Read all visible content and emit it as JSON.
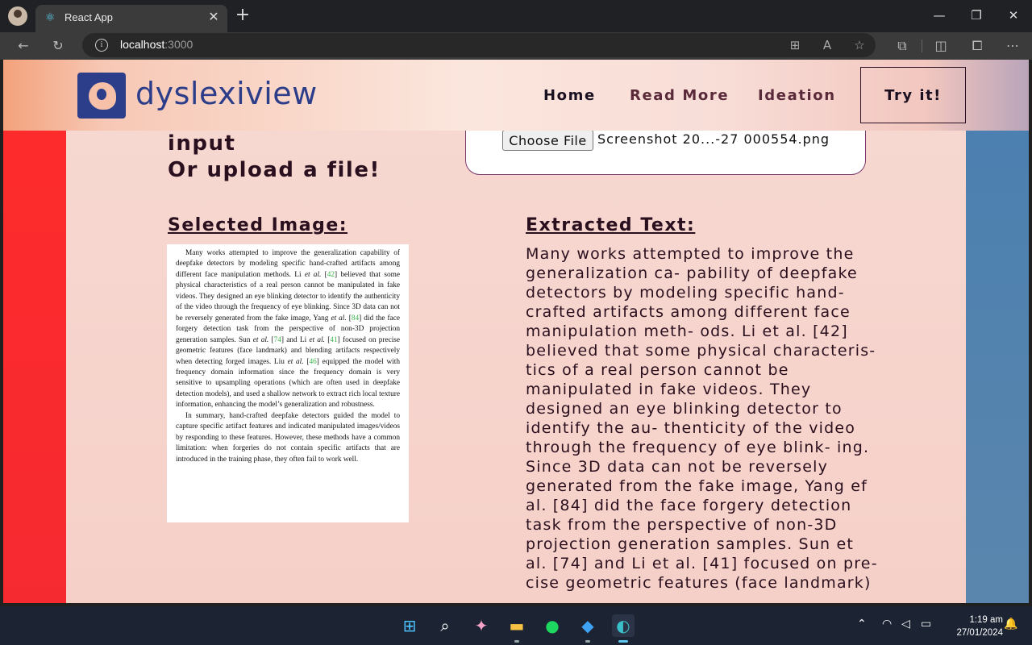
{
  "browser": {
    "tab_title": "React App",
    "url_host": "localhost",
    "url_port": ":3000"
  },
  "site": {
    "brand": "dyslexiview",
    "nav": [
      "Home",
      "Read More",
      "Ideation"
    ],
    "cta": "Try it!"
  },
  "upload": {
    "line1": "input",
    "line2": "Or upload a file!",
    "choose_button": "Choose File",
    "file_name": "Screenshot 20...-27 000554.png"
  },
  "selected": {
    "title": "Selected Image:",
    "para1": [
      {
        "t": "Many works attempted to improve the generalization capability of deepfake detectors by modeling specific hand-crafted artifacts among different face manipulation methods. Li "
      },
      {
        "t": "et al.",
        "i": true
      },
      {
        "t": " ["
      },
      {
        "t": "42",
        "c": true
      },
      {
        "t": "] believed that some physical characteristics of a real person cannot be manipulated in fake videos. They designed an eye blinking detector to identify the authenticity of the video through the frequency of eye blinking. Since 3D data can not be reversely generated from the fake image, Yang "
      },
      {
        "t": "et al.",
        "i": true
      },
      {
        "t": " ["
      },
      {
        "t": "84",
        "c": true
      },
      {
        "t": "] did the face forgery detection task from the perspective of non-3D projection generation samples. Sun "
      },
      {
        "t": "et al.",
        "i": true
      },
      {
        "t": " ["
      },
      {
        "t": "74",
        "c": true
      },
      {
        "t": "] and Li "
      },
      {
        "t": "et al.",
        "i": true
      },
      {
        "t": " ["
      },
      {
        "t": "41",
        "c": true
      },
      {
        "t": "] focused on precise geometric features (face landmark) and blending artifacts respectively when detecting forged images. Liu "
      },
      {
        "t": "et al.",
        "i": true
      },
      {
        "t": " ["
      },
      {
        "t": "46",
        "c": true
      },
      {
        "t": "] equipped the model with frequency domain information since the frequency domain is very sensitive to upsampling operations (which are often used in deepfake detection models), and used a shallow network to extract rich local texture information, enhancing the model’s generalization and robustness."
      }
    ],
    "para2": "In summary, hand-crafted deepfake detectors guided the model to capture specific artifact features and indicated manipulated images/videos by responding to these features. However, these methods have a common limitation: when forgeries do not contain specific artifacts that are introduced in the training phase, they often fail to work well."
  },
  "extracted": {
    "title": "Extracted Text:",
    "text": "Many works attempted to improve the generalization ca- pability of deepfake detectors by modeling specific hand-crafted artifacts among different face manipulation meth- ods. Li et al. [42] believed that some physical characteris- tics of a real person cannot be manipulated in fake videos. They designed an eye blinking detector to identify the au- thenticity of the video through the frequency of eye blink- ing. Since 3D data can not be reversely generated from the fake image, Yang ef al. [84] did the face forgery detection task from the perspective of non-3D projection generation samples. Sun et al. [74] and Li et al. [41] focused on pre- cise geometric features (face landmark)"
  },
  "taskbar": {
    "time": "1:19 am",
    "date": "27/01/2024"
  },
  "colors": {
    "brand": "#2c3e8a",
    "left_strip": "#ff2b2b",
    "right_strip": "#4a7fb0",
    "citation": "#3ab54a"
  }
}
